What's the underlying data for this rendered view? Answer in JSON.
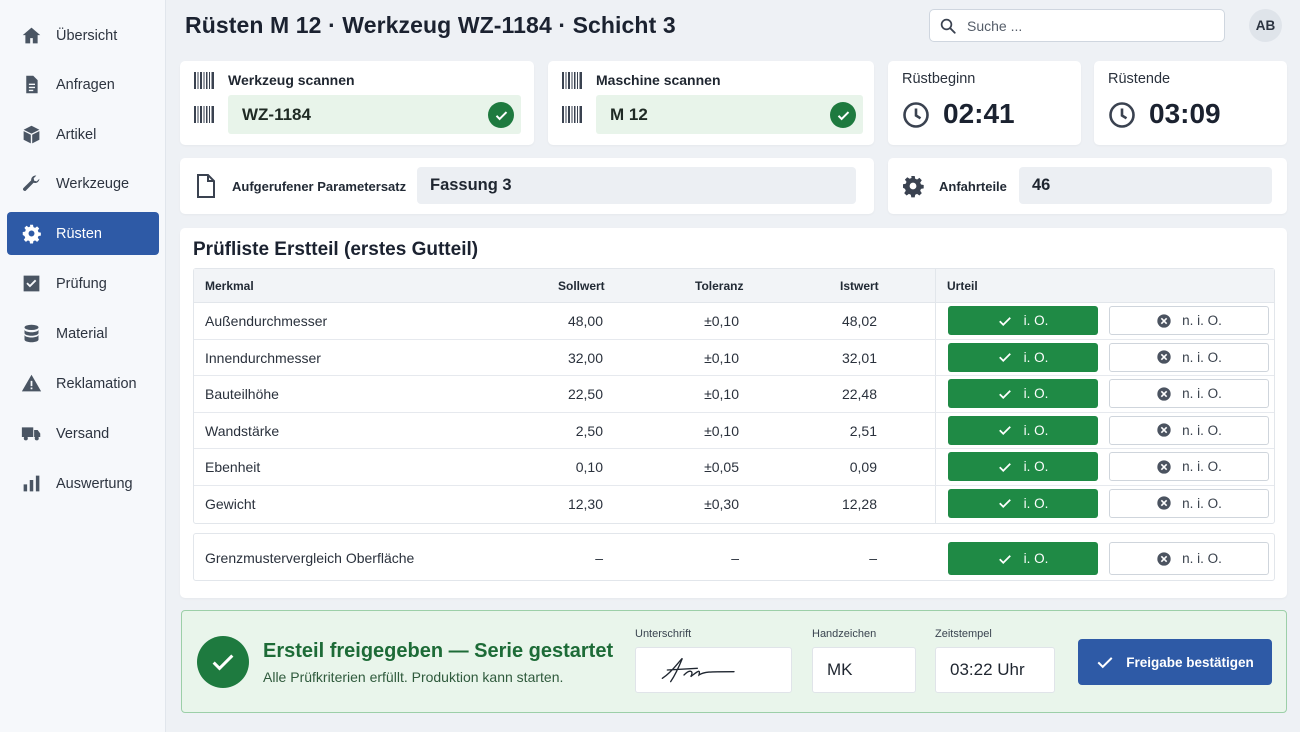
{
  "sidebar": {
    "items": [
      {
        "label": "Übersicht",
        "icon": "home-icon"
      },
      {
        "label": "Anfragen",
        "icon": "document-icon"
      },
      {
        "label": "Artikel",
        "icon": "box-icon"
      },
      {
        "label": "Werkzeuge",
        "icon": "wrench-icon"
      },
      {
        "label": "Rüsten",
        "icon": "gear-icon",
        "active": true
      },
      {
        "label": "Prüfung",
        "icon": "checkbox-icon"
      },
      {
        "label": "Material",
        "icon": "database-icon"
      },
      {
        "label": "Reklamation",
        "icon": "warning-icon"
      },
      {
        "label": "Versand",
        "icon": "truck-icon"
      },
      {
        "label": "Auswertung",
        "icon": "bar-chart-icon"
      }
    ]
  },
  "header": {
    "title": "Rüsten M 12 · Werkzeug WZ-1184 · Schicht 3",
    "search_placeholder": "Suche ...",
    "avatar": "AB"
  },
  "scan": {
    "tool_title": "Werkzeug scannen",
    "tool_value": "WZ-1184",
    "machine_title": "Maschine scannen",
    "machine_value": "M 12"
  },
  "times": {
    "start_label": "Rüstbeginn",
    "start_value": "02:41",
    "end_label": "Rüstende",
    "end_value": "03:09"
  },
  "params": {
    "set_label": "Aufgerufener Parametersatz",
    "set_value": "Fassung 3",
    "anfahrteile_label": "Anfahrteile",
    "anfahrteile_value": "46"
  },
  "checklist": {
    "title": "Prüfliste Erstteil (erstes Gutteil)",
    "headers": {
      "merkmal": "Merkmal",
      "sollwert": "Sollwert",
      "toleranz": "Toleranz",
      "istwert": "Istwert",
      "urteil": "Urteil"
    },
    "io_label": "i. O.",
    "nio_label": "n. i. O.",
    "rows": [
      {
        "merkmal": "Außendurchmesser",
        "sollwert": "48,00",
        "toleranz": "±0,10",
        "istwert": "48,02"
      },
      {
        "merkmal": "Innendurchmesser",
        "sollwert": "32,00",
        "toleranz": "±0,10",
        "istwert": "32,01"
      },
      {
        "merkmal": "Bauteilhöhe",
        "sollwert": "22,50",
        "toleranz": "±0,10",
        "istwert": "22,48"
      },
      {
        "merkmal": "Wandstärke",
        "sollwert": "2,50",
        "toleranz": "±0,10",
        "istwert": "2,51"
      },
      {
        "merkmal": "Ebenheit",
        "sollwert": "0,10",
        "toleranz": "±0,05",
        "istwert": "0,09"
      },
      {
        "merkmal": "Gewicht",
        "sollwert": "12,30",
        "toleranz": "±0,30",
        "istwert": "12,28"
      }
    ],
    "extra": {
      "merkmal": "Grenzmustervergleich Oberfläche",
      "sollwert": "–",
      "toleranz": "–",
      "istwert": "–"
    }
  },
  "release": {
    "title": "Ersteil freigegeben — Serie gestartet",
    "subtitle": "Alle Prüfkriterien erfüllt. Produktion kann starten.",
    "signature_label": "Unterschrift",
    "initials_label": "Handzeichen",
    "initials_value": "MK",
    "timestamp_label": "Zeitstempel",
    "timestamp_value": "03:22 Uhr",
    "confirm_label": "Freigabe bestätigen"
  },
  "colors": {
    "primary": "#2e5aa6",
    "success": "#1f8a45",
    "success_dark": "#1e7a3f"
  }
}
